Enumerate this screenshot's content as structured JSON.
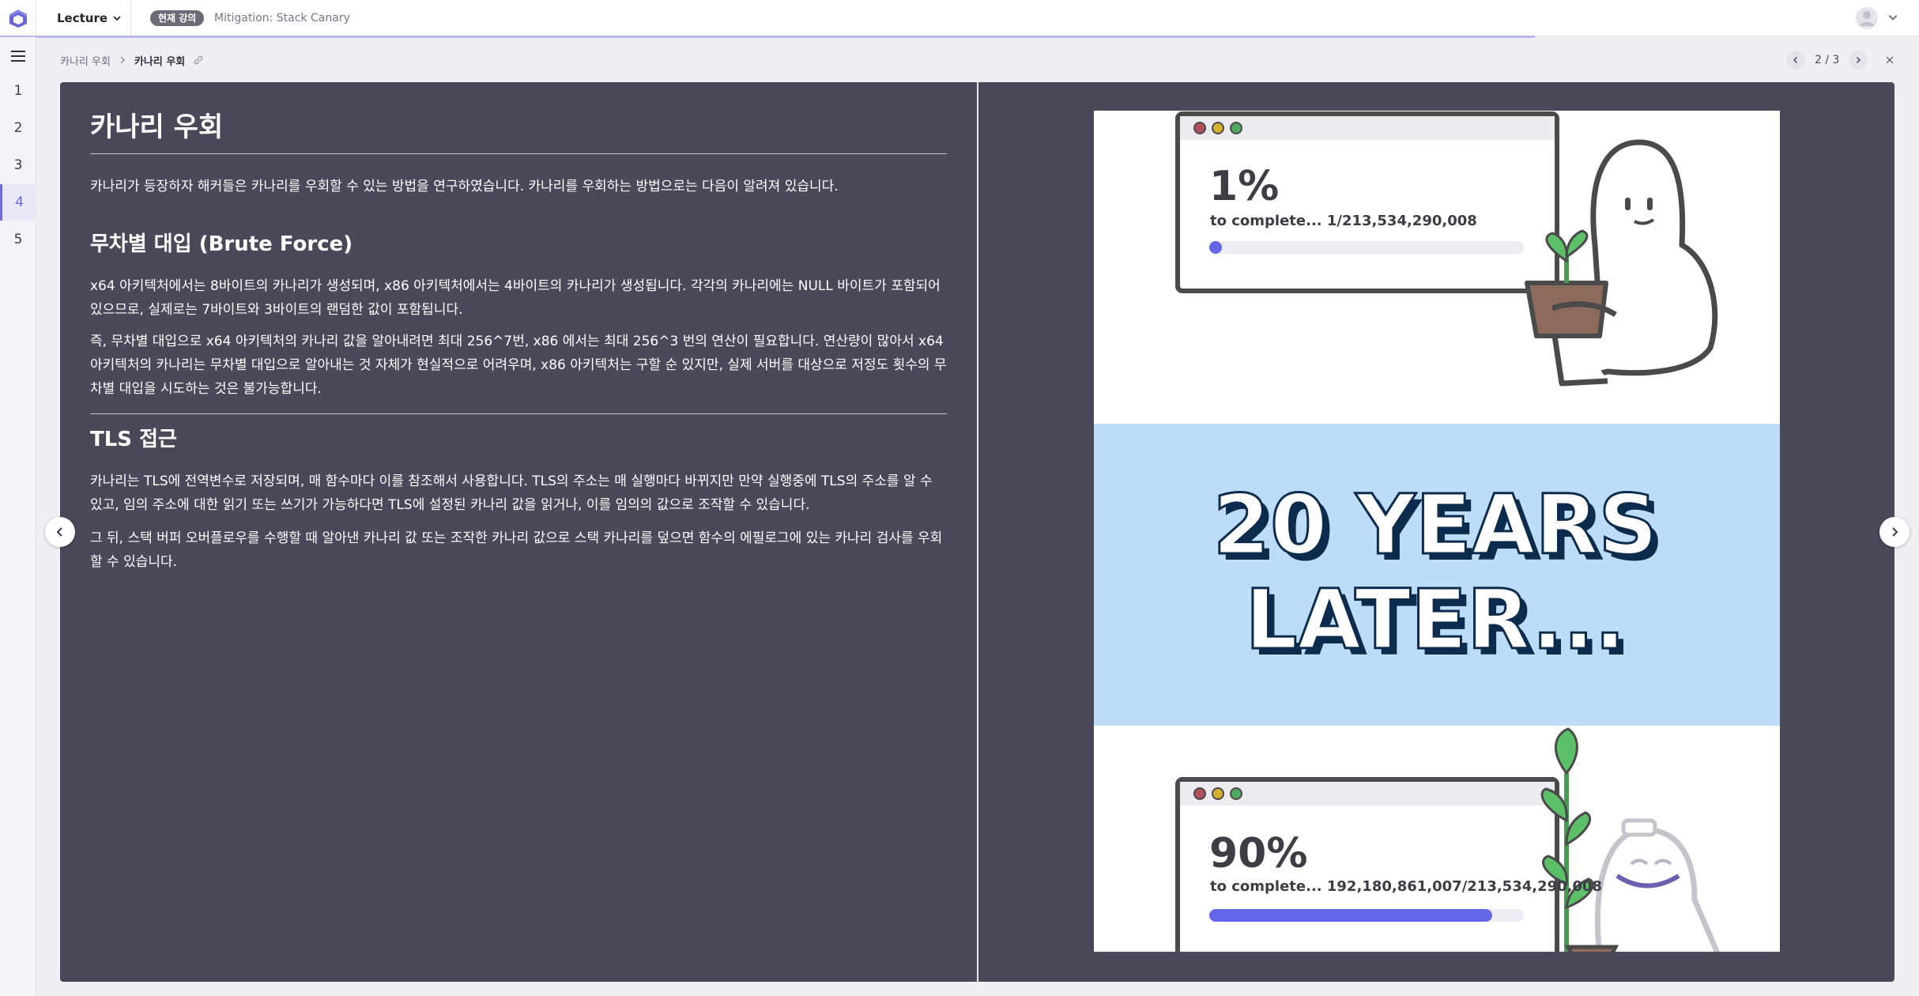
{
  "topbar": {
    "lecture_label": "Lecture",
    "current_badge": "현재 강의",
    "current_title": "Mitigation: Stack Canary",
    "progress": 0.8
  },
  "sidebar": {
    "items": [
      {
        "label": "1"
      },
      {
        "label": "2"
      },
      {
        "label": "3"
      },
      {
        "label": "4"
      },
      {
        "label": "5"
      }
    ],
    "active_index": 3
  },
  "breadcrumb": {
    "parent": "카나리 우회",
    "current": "카나리 우회"
  },
  "pager": {
    "text": "2 / 3"
  },
  "slide": {
    "title": "카나리 우회",
    "intro": "카나리가 등장하자 해커들은 카나리를 우회할 수 있는 방법을 연구하였습니다. 카나리를 우회하는 방법으로는 다음이 알려져 있습니다.",
    "brute_heading": "무차별 대입 (Brute Force)",
    "brute_p1": "x64 아키텍처에서는 8바이트의 카나리가 생성되며, x86 아키텍처에서는 4바이트의 카나리가 생성됩니다. 각각의 카나리에는 NULL 바이트가 포함되어 있으므로, 실제로는 7바이트와 3바이트의 랜덤한 값이 포함됩니다.",
    "brute_p2": "즉, 무차별 대입으로 x64 아키텍처의 카나리 값을 알아내려면 최대 256^7번, x86 에서는 최대 256^3 번의 연산이 필요합니다. 연산량이 많아서 x64 아키텍처의 카나리는 무차별 대입으로 알아내는 것 자체가 현실적으로 어려우며, x86 아키텍처는 구할 순 있지만, 실제 서버를 대상으로 저정도 횟수의 무차별 대입을 시도하는 것은 불가능합니다.",
    "tls_heading": "TLS 접근",
    "tls_p1": "카나리는 TLS에 전역변수로 저장되며, 매 함수마다 이를 참조해서 사용합니다. TLS의 주소는 매 실행마다 바뀌지만 만약 실행중에 TLS의 주소를 알 수 있고, 임의 주소에 대한 읽기 또는 쓰기가 가능하다면 TLS에 설정된 카나리 값을 읽거나, 이를 임의의 값으로 조작할 수 있습니다.",
    "tls_p2": "그 뒤, 스택 버퍼 오버플로우를 수행할 때 알아낸 카나리 값 또는 조작한 카나리 값으로 스택 카나리를 덮으면 함수의 에필로그에 있는 카나리 검사를 우회할 수 있습니다."
  },
  "meme": {
    "top_percent": "1%",
    "top_complete": "to complete... 1/213,534,290,008",
    "top_progress": 0.04,
    "middle_line1": "20 YEARS",
    "middle_line2": "LATER...",
    "bottom_percent": "90%",
    "bottom_complete": "to complete... 192,180,861,007/213,534,290,008",
    "bottom_progress": 0.9
  },
  "colors": {
    "accent": "#6d6be0",
    "slide_bg": "#4a4859",
    "meme_band": "#bcdcf8",
    "meme_text": "#0d2c4d",
    "meme_progress": "#6366e6"
  }
}
